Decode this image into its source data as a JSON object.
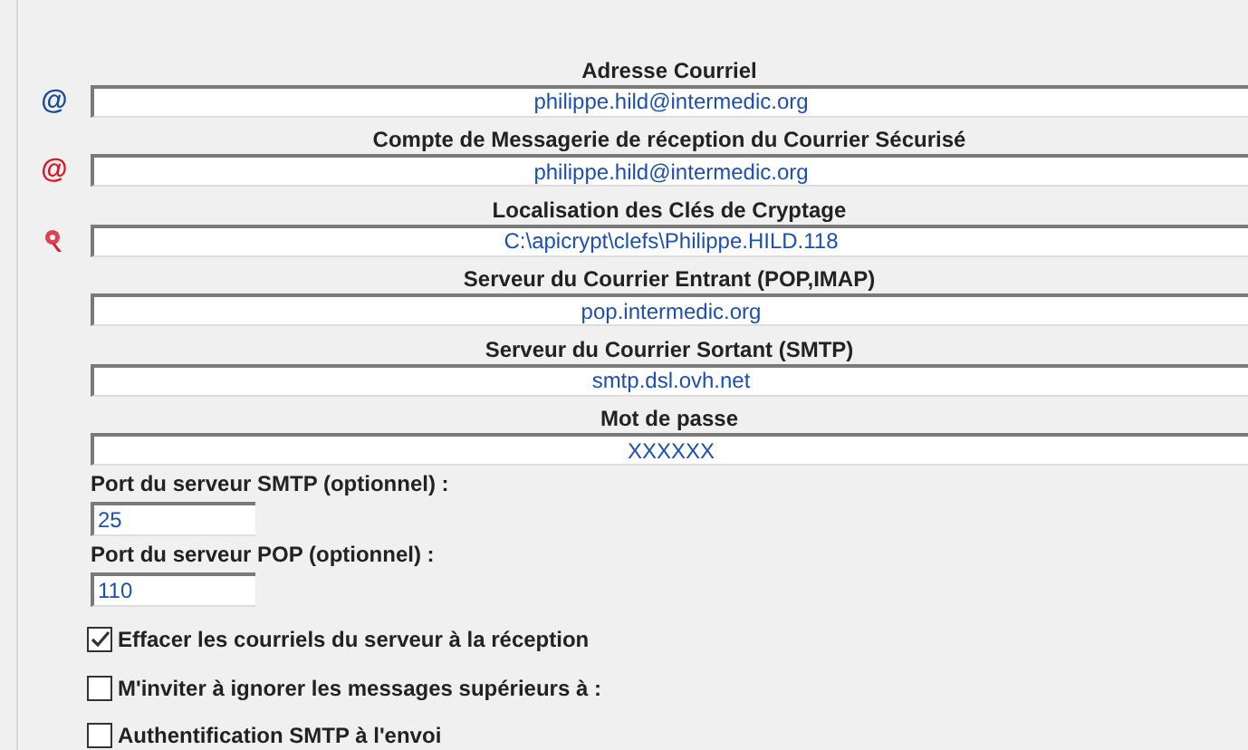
{
  "fields": [
    {
      "kind": "mail",
      "icon_glyph": "@",
      "label": "Adresse Courriel",
      "value": "philippe.hild@intermedic.org"
    },
    {
      "kind": "secure",
      "icon_glyph": "@",
      "label": "Compte de Messagerie de réception du Courrier Sécurisé",
      "value": "philippe.hild@intermedic.org"
    },
    {
      "kind": "key",
      "label": "Localisation des Clés de Cryptage",
      "value": "C:\\apicrypt\\clefs\\Philippe.HILD.118"
    },
    {
      "kind": "plain",
      "label": "Serveur du Courrier Entrant (POP,IMAP)",
      "value": "pop.intermedic.org"
    },
    {
      "kind": "plain",
      "label": "Serveur du Courrier Sortant (SMTP)",
      "value": "smtp.dsl.ovh.net"
    },
    {
      "kind": "plain",
      "label": "Mot de passe",
      "value": "XXXXXX"
    }
  ],
  "ports": [
    {
      "label": "Port du serveur SMTP (optionnel) :",
      "value": "25"
    },
    {
      "label": "Port du serveur POP (optionnel) :",
      "value": "110"
    }
  ],
  "options": [
    {
      "label": "Effacer les courriels du serveur à la réception",
      "checked": true
    },
    {
      "label": "M'inviter à ignorer les messages supérieurs à :",
      "checked": false
    },
    {
      "label": "Authentification SMTP à l'envoi",
      "checked": false
    }
  ]
}
